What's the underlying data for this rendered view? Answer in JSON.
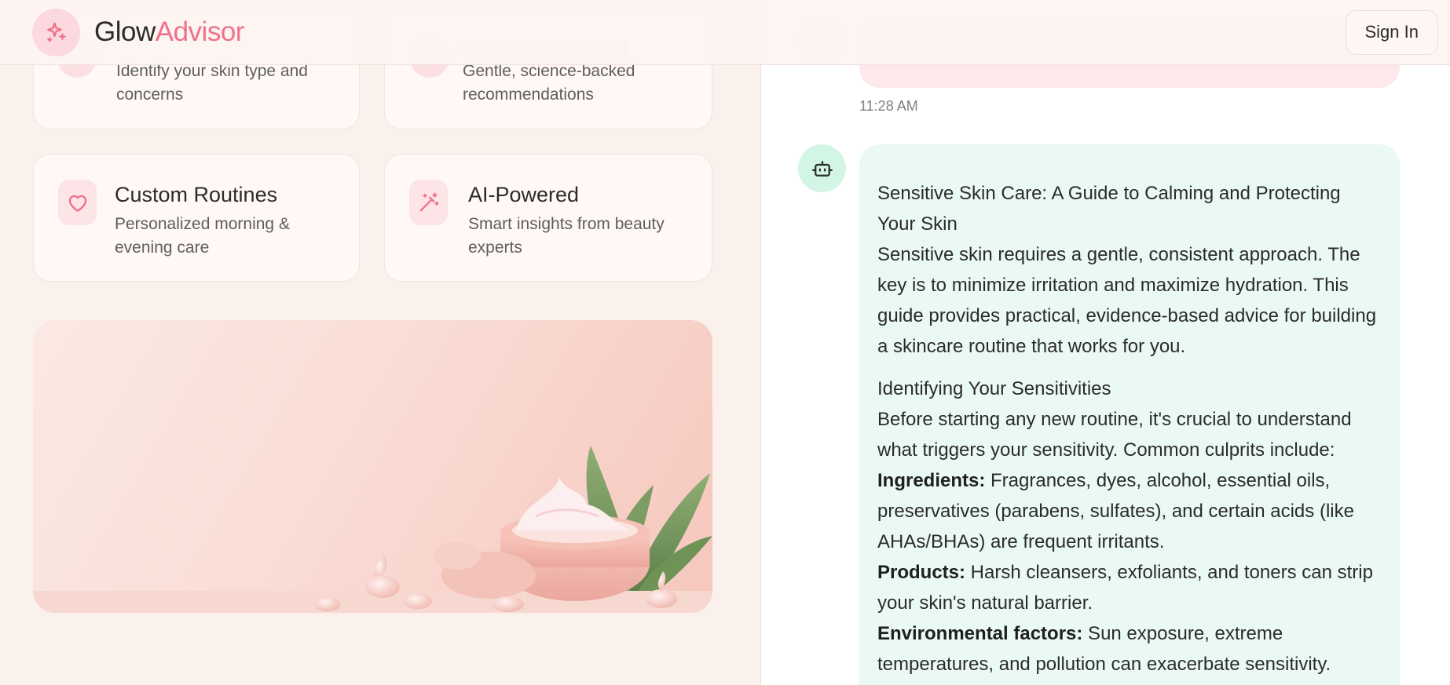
{
  "brand": {
    "name_part1": "Glow",
    "name_part2": "Advisor"
  },
  "header": {
    "signin_label": "Sign In"
  },
  "features": [
    {
      "title": "",
      "desc": "Identify your skin type and concerns",
      "icon": "sparkle-icon"
    },
    {
      "title": "",
      "desc": "Gentle, science-backed recommendations",
      "icon": "leaf-icon"
    },
    {
      "title": "Custom Routines",
      "desc": "Personalized morning & evening care",
      "icon": "heart-icon"
    },
    {
      "title": "AI-Powered",
      "desc": "Smart insights from beauty experts",
      "icon": "magic-wand-icon"
    }
  ],
  "chat": {
    "timestamp": "11:28 AM",
    "bot_message": {
      "title": "Sensitive Skin Care: A Guide to Calming and Protecting Your Skin",
      "intro": "Sensitive skin requires a gentle, consistent approach. The key is to minimize irritation and maximize hydration. This guide provides practical, evidence-based advice for building a skincare routine that works for you.",
      "section_title": "Identifying Your Sensitivities",
      "section_intro": "Before starting any new routine, it's crucial to understand what triggers your sensitivity. Common culprits include:",
      "items": [
        {
          "label": "Ingredients:",
          "text": " Fragrances, dyes, alcohol, essential oils, preservatives (parabens, sulfates), and certain acids (like AHAs/BHAs) are frequent irritants."
        },
        {
          "label": "Products:",
          "text": " Harsh cleansers, exfoliants, and toners can strip your skin's natural barrier."
        },
        {
          "label": "Environmental factors:",
          "text": " Sun exposure, extreme temperatures, and pollution can exacerbate sensitivity."
        }
      ]
    }
  },
  "colors": {
    "accent": "#f07189",
    "background": "#faf0ec",
    "bot_bubble": "#eafaf2",
    "user_bubble": "#fde8ec"
  }
}
